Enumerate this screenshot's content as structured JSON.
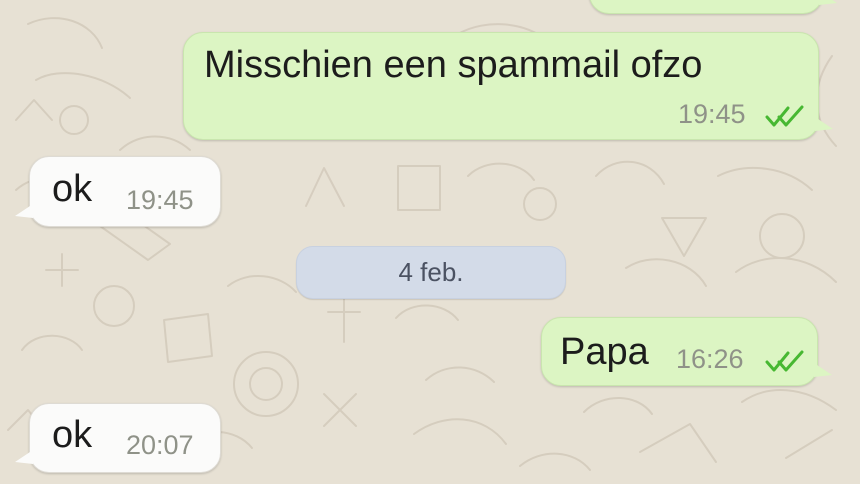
{
  "messages": [
    {
      "direction": "outgoing",
      "text": "Misschien een spammail ofzo",
      "time": "19:45",
      "status": "read"
    },
    {
      "direction": "incoming",
      "text": "ok",
      "time": "19:45"
    },
    {
      "direction": "outgoing",
      "text": "Papa",
      "time": "16:26",
      "status": "read"
    },
    {
      "direction": "incoming",
      "text": "ok",
      "time": "20:07"
    }
  ],
  "date_separator": "4 feb.",
  "icons": {
    "read_receipt": "double-check-icon",
    "background": "chat-wallpaper-doodles"
  },
  "colors": {
    "outgoing_bubble": "#dcf5c3",
    "incoming_bubble": "#fbfbfa",
    "date_chip": "#d3dbe8",
    "read_receipt": "#47b832",
    "background": "#e7e1d4"
  }
}
